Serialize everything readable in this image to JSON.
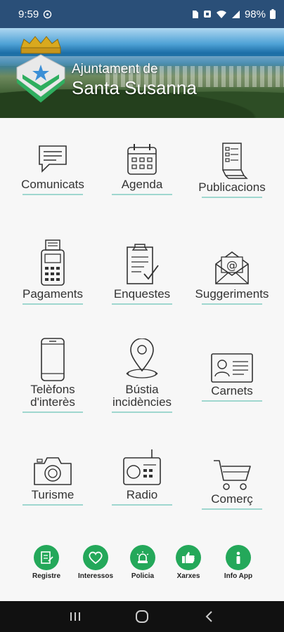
{
  "status_bar": {
    "time": "9:59",
    "battery": "98%",
    "icons": [
      "sync-icon",
      "sim-icon",
      "alarm-icon",
      "wifi-icon",
      "signal-icon",
      "battery-icon"
    ]
  },
  "header": {
    "title_line1": "Ajuntament de",
    "title_line2": "Santa Susanna"
  },
  "menu": [
    {
      "label": "Comunicats",
      "icon": "chat-icon"
    },
    {
      "label": "Agenda",
      "icon": "calendar-icon"
    },
    {
      "label": "Publicacions",
      "icon": "documents-icon"
    },
    {
      "label": "Pagaments",
      "icon": "payment-terminal-icon"
    },
    {
      "label": "Enquestes",
      "icon": "clipboard-check-icon"
    },
    {
      "label": "Suggeriments",
      "icon": "envelope-at-icon"
    },
    {
      "label": "Telèfons",
      "label2": "d'interès",
      "icon": "phone-icon"
    },
    {
      "label": "Bústia",
      "label2": "incidències",
      "icon": "location-pin-icon"
    },
    {
      "label": "Carnets",
      "icon": "id-card-icon"
    },
    {
      "label": "Turisme",
      "icon": "camera-icon"
    },
    {
      "label": "Radio",
      "icon": "radio-icon"
    },
    {
      "label": "Comerç",
      "icon": "shopping-cart-icon"
    }
  ],
  "quick_links": [
    {
      "label": "Registre",
      "icon": "register-icon"
    },
    {
      "label": "Interessos",
      "icon": "heart-icon"
    },
    {
      "label": "Policia",
      "icon": "siren-icon"
    },
    {
      "label": "Xarxes",
      "icon": "thumbs-up-icon"
    },
    {
      "label": "Info App",
      "icon": "info-icon"
    }
  ],
  "colors": {
    "status_bar": "#2a4f78",
    "accent_green": "#24a85a",
    "underline": "#9fd7cf",
    "nav_bar": "#111111"
  }
}
